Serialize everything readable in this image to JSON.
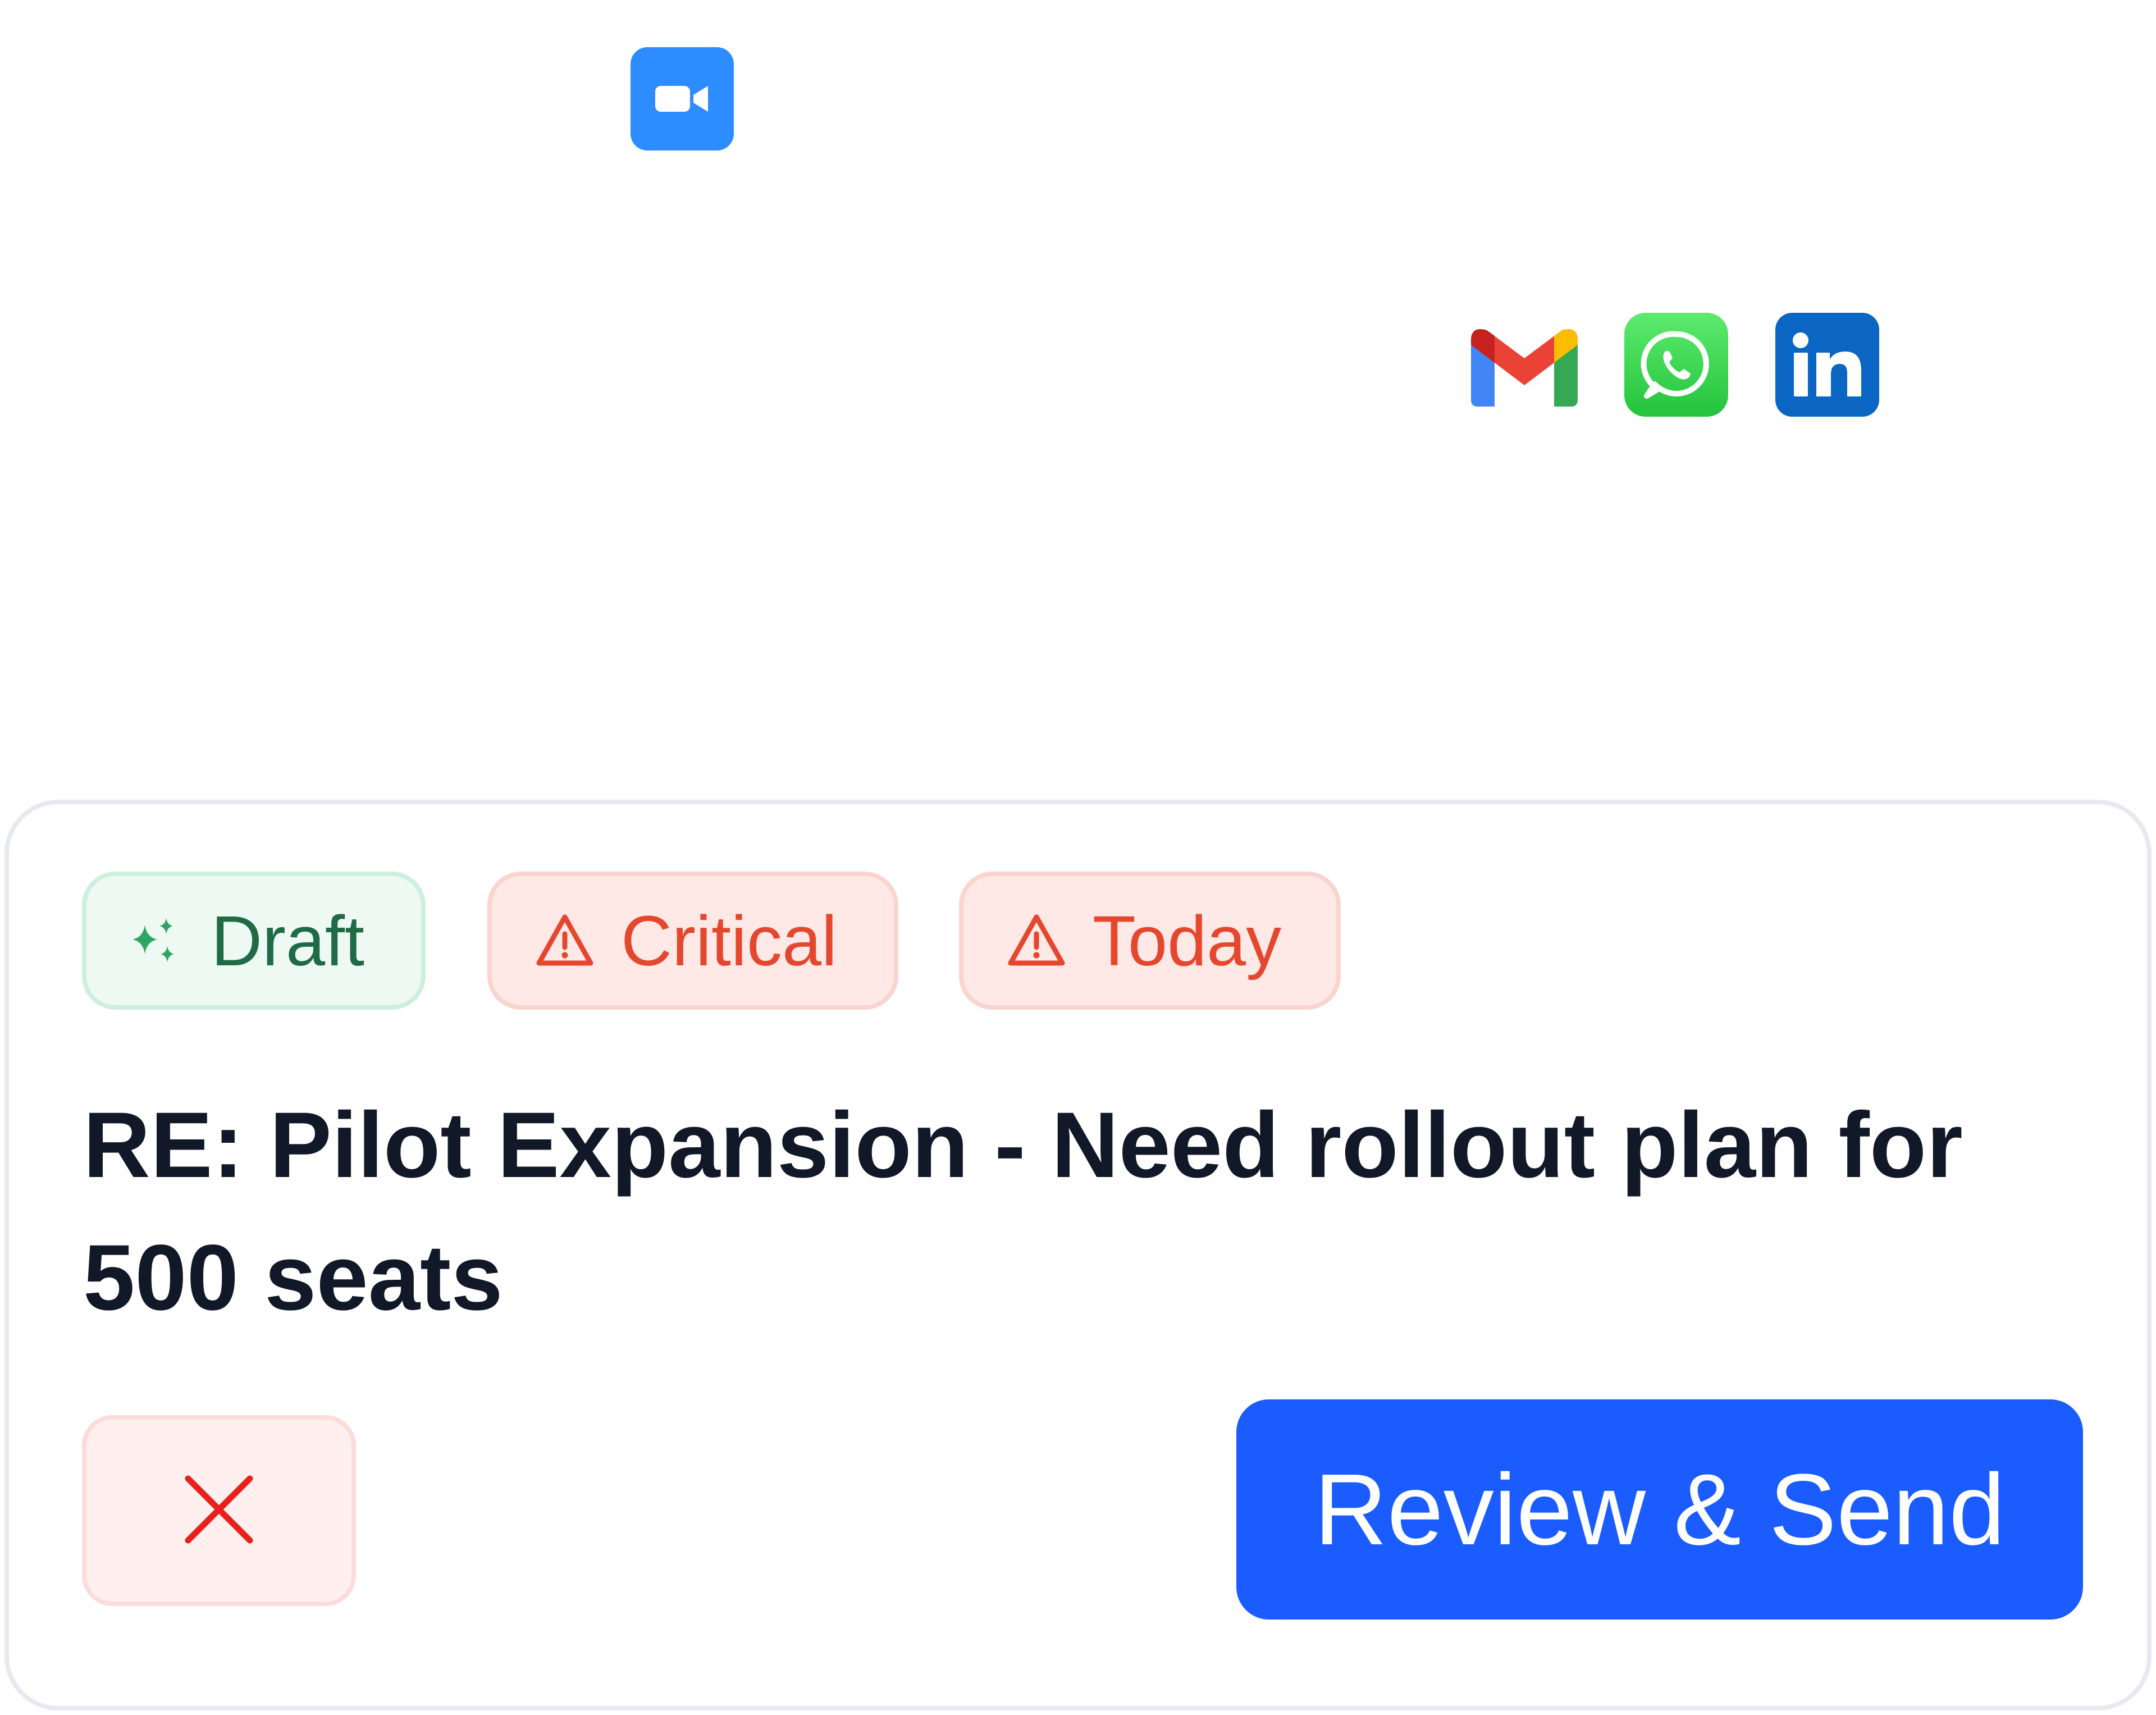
{
  "apps": {
    "top": {
      "icon": "zoom-video-icon",
      "color": "#2D8CFF"
    },
    "row": [
      {
        "icon": "gmail-icon"
      },
      {
        "icon": "whatsapp-icon",
        "color": "#25D366"
      },
      {
        "icon": "linkedin-icon",
        "color": "#0A66C2",
        "text": "in"
      }
    ]
  },
  "card": {
    "badges": [
      {
        "label": "Draft",
        "icon": "sparkles-icon",
        "color": "#1E6B46"
      },
      {
        "label": "Critical",
        "icon": "warning-triangle-icon",
        "color": "#E5472E"
      },
      {
        "label": "Today",
        "icon": "warning-triangle-icon",
        "color": "#E5472E"
      }
    ],
    "subject": "RE: Pilot Expansion - Need rollout plan for 500 seats",
    "actions": {
      "dismiss_icon": "close-icon",
      "dismiss_color": "#E8221B",
      "send_label": "Review & Send",
      "send_color": "#1B5CFF"
    }
  }
}
